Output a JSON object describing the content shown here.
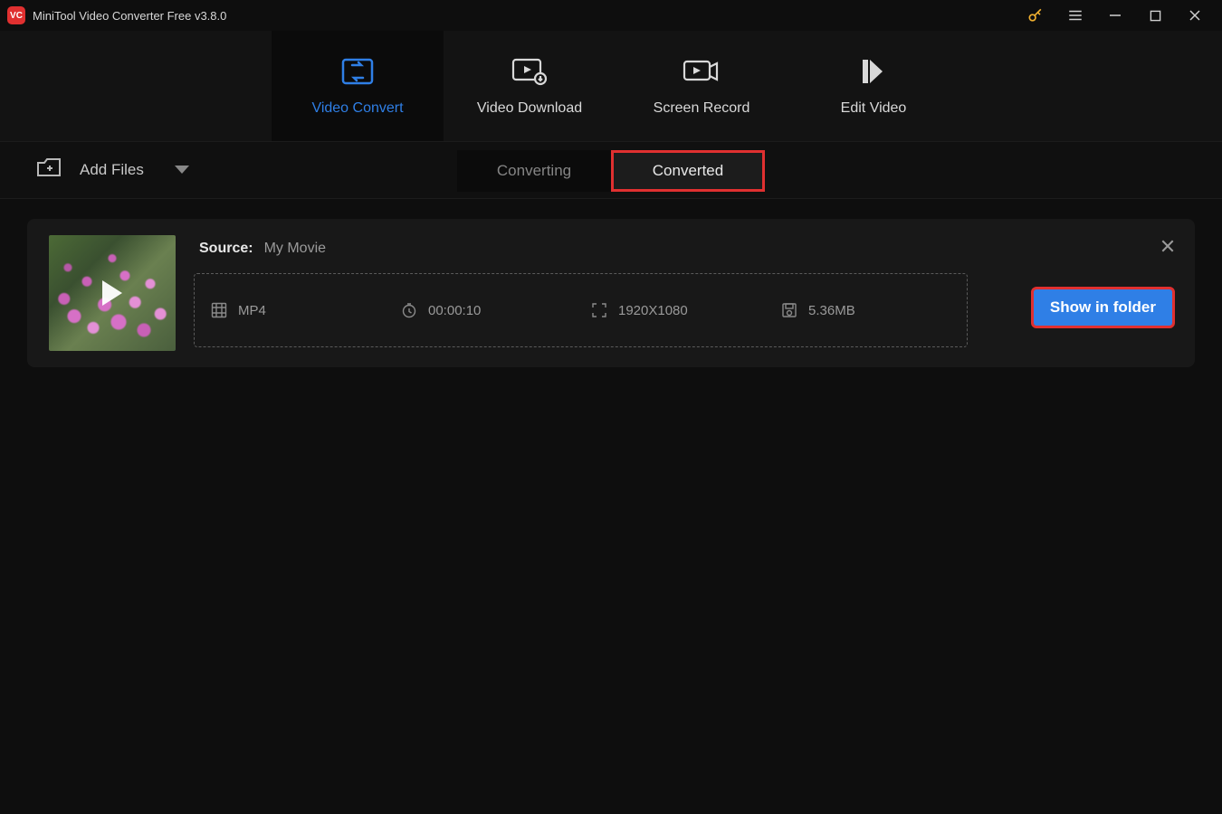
{
  "titlebar": {
    "title": "MiniTool Video Converter Free v3.8.0"
  },
  "nav": {
    "video_convert": "Video Convert",
    "video_download": "Video Download",
    "screen_record": "Screen Record",
    "edit_video": "Edit Video"
  },
  "toolbar": {
    "add_files": "Add Files",
    "converting": "Converting",
    "converted": "Converted"
  },
  "card": {
    "source_label": "Source:",
    "source_value": "My Movie",
    "format": "MP4",
    "duration": "00:00:10",
    "resolution": "1920X1080",
    "size": "5.36MB",
    "show_in_folder": "Show in folder"
  }
}
